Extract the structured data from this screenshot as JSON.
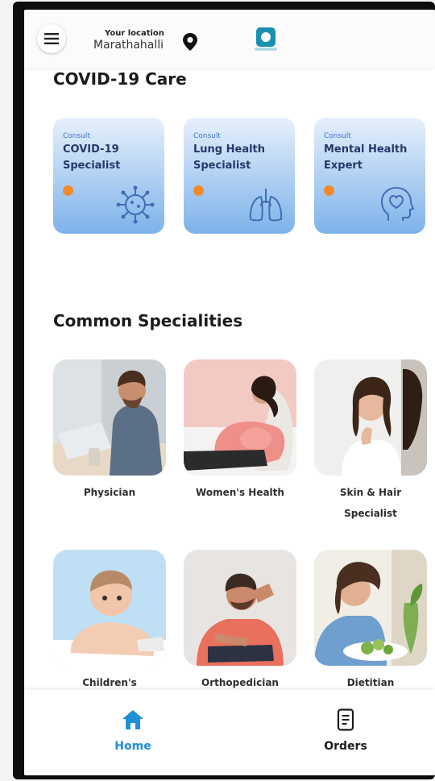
{
  "header": {
    "location_label": "Your location",
    "location_value": "Marathahalli"
  },
  "covid_section": {
    "title": "COVID-19 Care",
    "cards": [
      {
        "kicker": "Consult",
        "title": "COVID-19 Specialist",
        "icon": "virus-icon"
      },
      {
        "kicker": "Consult",
        "title": "Lung Health Specialist",
        "icon": "lungs-icon"
      },
      {
        "kicker": "Consult",
        "title": "Mental Health Expert",
        "icon": "mind-icon"
      }
    ]
  },
  "specialities_section": {
    "title": "Common Specialities",
    "items": [
      {
        "label": "Physician"
      },
      {
        "label": "Women's Health"
      },
      {
        "label": "Skin & Hair Specialist"
      },
      {
        "label": "Children's"
      },
      {
        "label": "Orthopedician"
      },
      {
        "label": "Dietitian"
      }
    ]
  },
  "bottom_nav": {
    "items": [
      {
        "label": "Home",
        "icon": "home-icon",
        "active": true
      },
      {
        "label": "Orders",
        "icon": "orders-icon",
        "active": false
      }
    ]
  },
  "colors": {
    "accent": "#1f8fd6",
    "consult_gradient_top": "#e7f0fb",
    "consult_gradient_bottom": "#7db2ea",
    "dot": "#f28a2b"
  }
}
